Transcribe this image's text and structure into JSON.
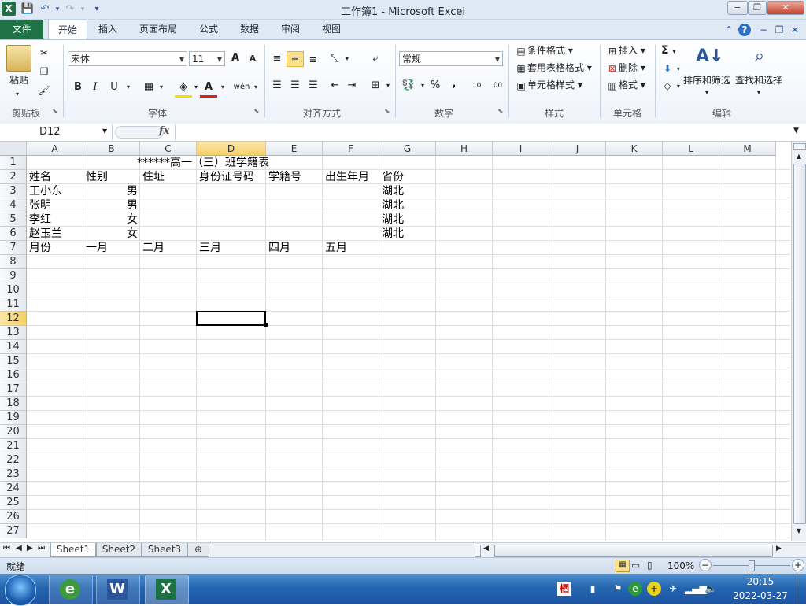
{
  "window": {
    "title": "工作簿1 - Microsoft Excel",
    "controls": [
      "−",
      "❐",
      "✕"
    ],
    "ribbon_controls": [
      "⌃",
      "?",
      "−",
      "❐",
      "✕"
    ]
  },
  "qat": {
    "save": "💾",
    "undo": "↶",
    "redo": "↷",
    "customize": "▾"
  },
  "tabs": [
    "文件",
    "开始",
    "插入",
    "页面布局",
    "公式",
    "数据",
    "审阅",
    "视图"
  ],
  "ribbon": {
    "clipboard": {
      "label": "剪贴板",
      "paste": "粘贴"
    },
    "font": {
      "label": "字体",
      "name": "宋体",
      "size": "11",
      "grow": "A",
      "shrink": "A",
      "bold": "B",
      "italic": "I",
      "underline": "U",
      "font_color": "A",
      "phonetic": "wén"
    },
    "alignment": {
      "label": "对齐方式"
    },
    "number": {
      "label": "数字",
      "format": "常规",
      "percent": "%",
      "comma": ",",
      "inc": ".0",
      "dec": ".00"
    },
    "styles": {
      "label": "样式",
      "conditional": "条件格式",
      "table": "套用表格格式",
      "cell_styles": "单元格样式"
    },
    "cells": {
      "label": "单元格",
      "insert": "插入",
      "delete": "删除",
      "format": "格式"
    },
    "editing": {
      "label": "编辑",
      "sigma": "Σ",
      "sort_filter": "排序和筛选",
      "find_select": "查找和选择"
    }
  },
  "formula_bar": {
    "name_box": "D12",
    "fx": "fx",
    "content": ""
  },
  "sheet": {
    "columns": [
      "A",
      "B",
      "C",
      "D",
      "E",
      "F",
      "G",
      "H",
      "I",
      "J",
      "K",
      "L",
      "M"
    ],
    "rows": [
      "1",
      "2",
      "3",
      "4",
      "5",
      "6",
      "7",
      "8",
      "9",
      "10",
      "11",
      "12",
      "13",
      "14",
      "15",
      "16",
      "17",
      "18",
      "19",
      "20",
      "21",
      "22",
      "23",
      "24",
      "25",
      "26",
      "27"
    ],
    "cells": {
      "title": "******高一（三）班学籍表",
      "A2": "姓名",
      "B2": "性别",
      "C2": "住址",
      "D2": "身份证号码",
      "E2": "学籍号",
      "F2": "出生年月",
      "G2": "省份",
      "A3": "王小东",
      "B3": "男",
      "G3": "湖北",
      "A4": "张明",
      "B4": "男",
      "G4": "湖北",
      "A5": "李红",
      "B5": "女",
      "G5": "湖北",
      "A6": "赵玉兰",
      "B6": "女",
      "G6": "湖北",
      "A7": "月份",
      "B7": "一月",
      "C7": "二月",
      "D7": "三月",
      "E7": "四月",
      "F7": "五月"
    },
    "selected_cell": "D12"
  },
  "sheet_tabs": [
    "Sheet1",
    "Sheet2",
    "Sheet3"
  ],
  "status": {
    "ready": "就绪",
    "zoom": "100%",
    "zoom_out": "−",
    "zoom_in": "+"
  },
  "taskbar": {
    "time": "20:15",
    "date": "2022-03-27",
    "apps": [
      "ie",
      "word",
      "excel"
    ]
  }
}
